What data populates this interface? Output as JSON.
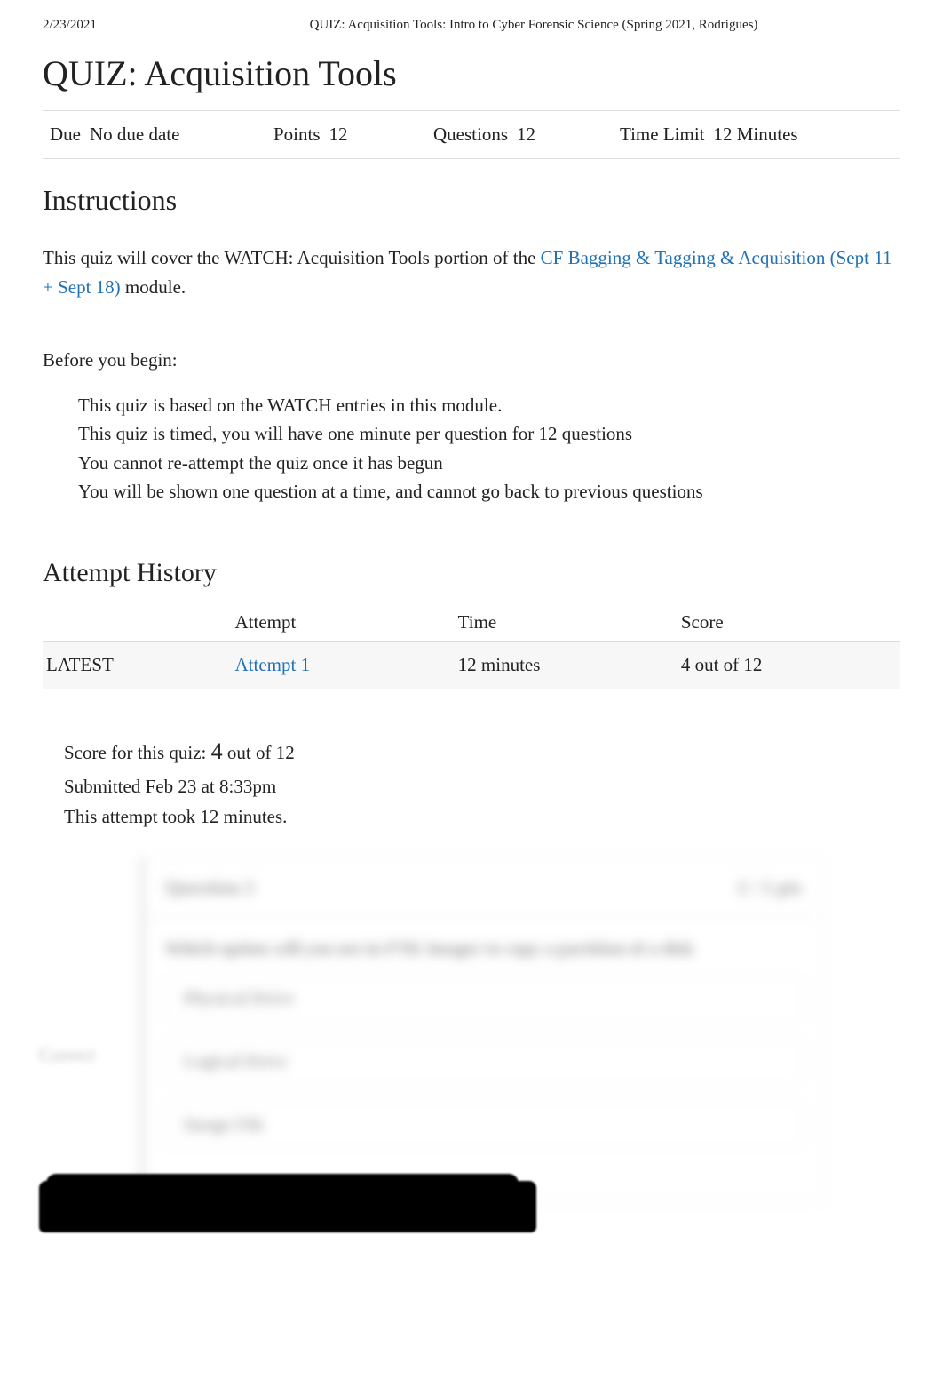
{
  "header": {
    "date": "2/23/2021",
    "context": "QUIZ: Acquisition Tools: Intro to Cyber Forensic Science (Spring 2021, Rodrigues)"
  },
  "title": "QUIZ: Acquisition Tools",
  "meta": {
    "due_label": "Due",
    "due_value": "No due date",
    "points_label": "Points",
    "points_value": "12",
    "questions_label": "Questions",
    "questions_value": "12",
    "timelimit_label": "Time Limit",
    "timelimit_value": "12 Minutes"
  },
  "instructions": {
    "heading": "Instructions",
    "intro_1": "This quiz will cover the ",
    "intro_2": "WATCH: Acquisition Tools",
    "intro_3": " portion of the ",
    "intro_link": "CF Bagging & Tagging & Acquisition (Sept 11 + Sept 18)",
    "intro_4": " module.",
    "before": "Before you begin:",
    "bullets": {
      "b1a": "This quiz is based on the ",
      "b1b": "WATCH",
      "b1c": " entries in this module.",
      "b2a": "This quiz is timed, you will have ",
      "b2b": "one minute",
      "b2c": " per question for ",
      "b2d": "12 questions",
      "b3a": "You ",
      "b3b": "cannot re-attempt",
      "b3c": " the quiz once it has begun",
      "b4a": "You will be shown ",
      "b4b": "one question",
      "b4c": " at a time, and cannot go back to previous questions"
    }
  },
  "attempt_history": {
    "heading": "Attempt History",
    "cols": {
      "c1": "",
      "c2": "Attempt",
      "c3": "Time",
      "c4": "Score"
    },
    "row": {
      "latest": "LATEST",
      "attempt": "Attempt 1",
      "time": "12 minutes",
      "score": "4 out of 12"
    }
  },
  "score_block": {
    "line1a": "Score for this quiz: ",
    "line1b": "4",
    "line1c": " out of 12",
    "line2": "Submitted Feb 23 at 8:33pm",
    "line3": "This attempt took 12 minutes."
  },
  "blurred": {
    "side": "Correct",
    "q_title": "Question 1",
    "q_pts": "1 / 1 pts",
    "q_text": "Which option will you use in FTK Imager to copy a partition of a disk",
    "opt1": "Physical Drive",
    "opt2": "Logical Drive",
    "opt3": "Image File"
  }
}
